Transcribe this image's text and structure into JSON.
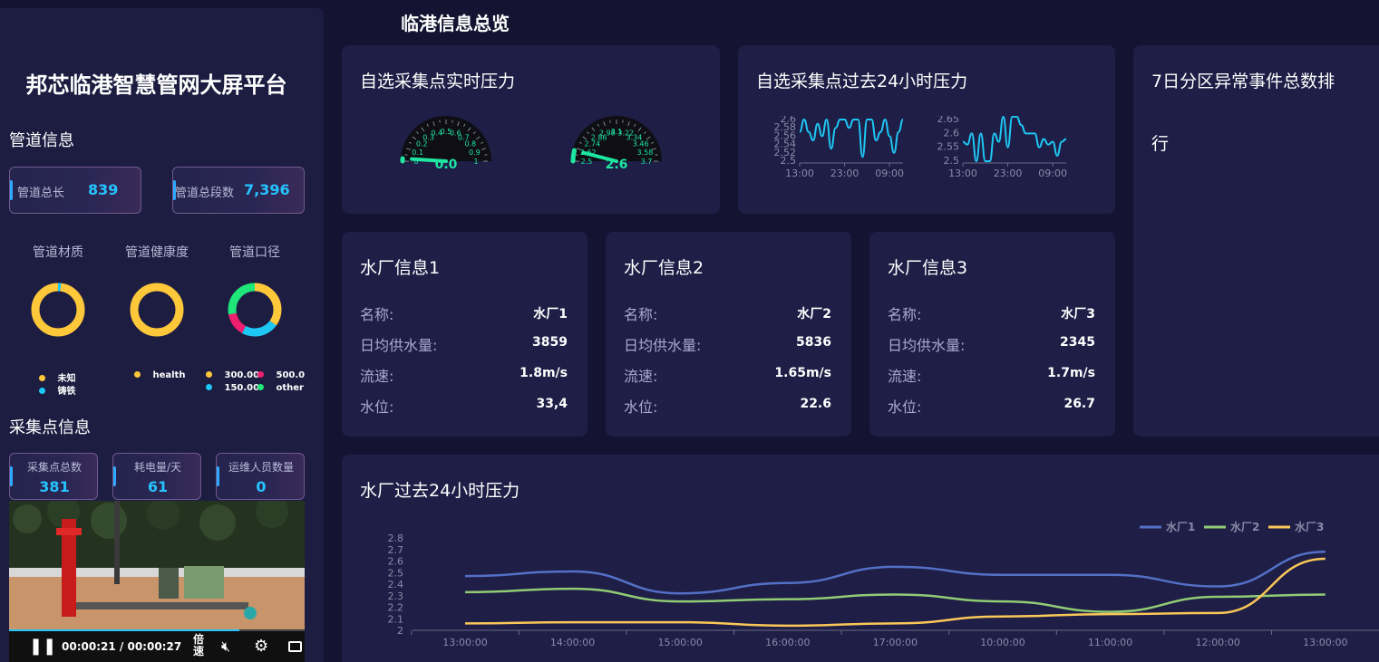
{
  "header": {
    "title": "临港信息总览"
  },
  "sidebar": {
    "title": "邦芯临港智慧管网大屏平台",
    "pipeline_section": "管道信息",
    "pipe_length": {
      "label": "管道总长",
      "value": "839"
    },
    "pipe_segments": {
      "label": "管道总段数",
      "value": "7,396"
    },
    "donuts": [
      {
        "title": "管道材质",
        "legend": [
          {
            "label": "未知",
            "color": "#ffc83a"
          },
          {
            "label": "铸铁",
            "color": "#1ec8f5"
          }
        ]
      },
      {
        "title": "管道健康度",
        "legend": [
          {
            "label": "health",
            "color": "#ffc83a"
          }
        ]
      },
      {
        "title": "管道口径",
        "legend": [
          {
            "label": "300.00",
            "color": "#ffc83a"
          },
          {
            "label": "500.0",
            "color": "#f01e6e"
          },
          {
            "label": "150.00",
            "color": "#1ec8f5"
          },
          {
            "label": "other",
            "color": "#1ee678"
          }
        ]
      }
    ],
    "collect_section": "采集点信息",
    "collect_stats": [
      {
        "label": "采集点总数",
        "value": "381"
      },
      {
        "label": "耗电量/天",
        "value": "61"
      },
      {
        "label": "运维人员数量",
        "value": "0"
      }
    ],
    "video": {
      "current_time": "00:00:21",
      "separator": "/",
      "duration": "00:00:27",
      "speed_label": "倍速",
      "progress": 0.78
    }
  },
  "realtime_pressure": {
    "title": "自选采集点实时压力",
    "gauges": [
      {
        "value": "0.0",
        "ticks": [
          "0",
          "0.1",
          "0.2",
          "0.3",
          "0.4",
          "0.5",
          "0.6",
          "0.7",
          "0.8",
          "0.9",
          "1"
        ],
        "fraction": 0.02
      },
      {
        "value": "2.6",
        "ticks": [
          "2.5",
          "2.62",
          "2.74",
          "2.86",
          "2.98",
          "3.1",
          "3.22",
          "3.34",
          "3.46",
          "3.58",
          "3.7"
        ],
        "fraction": 0.08
      }
    ]
  },
  "past24_pressure": {
    "title": "自选采集点过去24小时压力"
  },
  "anomaly_rank": {
    "title_line1": "7日分区异常事件总数排",
    "title_line2": "行"
  },
  "plants": [
    {
      "title": "水厂信息1",
      "rows": [
        {
          "k": "名称:",
          "v": "水厂1"
        },
        {
          "k": "日均供水量:",
          "v": "3859"
        },
        {
          "k": "流速:",
          "v": "1.8m/s"
        },
        {
          "k": "水位:",
          "v": "33,4"
        }
      ]
    },
    {
      "title": "水厂信息2",
      "rows": [
        {
          "k": "名称:",
          "v": "水厂2"
        },
        {
          "k": "日均供水量:",
          "v": "5836"
        },
        {
          "k": "流速:",
          "v": "1.65m/s"
        },
        {
          "k": "水位:",
          "v": "22.6"
        }
      ]
    },
    {
      "title": "水厂信息3",
      "rows": [
        {
          "k": "名称:",
          "v": "水厂3"
        },
        {
          "k": "日均供水量:",
          "v": "2345"
        },
        {
          "k": "流速:",
          "v": "1.7m/s"
        },
        {
          "k": "水位:",
          "v": "26.7"
        }
      ]
    }
  ],
  "plant_pressure": {
    "title": "水厂过去24小时压力"
  },
  "colors": {
    "accent": "#25c3ff",
    "panel": "#1e1e46",
    "background": "#141432"
  },
  "chart_data": [
    {
      "type": "line",
      "x": [
        "13:00",
        "14:00",
        "15:00",
        "16:00",
        "17:00",
        "18:00",
        "19:00",
        "20:00",
        "21:00",
        "22:00",
        "23:00",
        "00:00",
        "01:00",
        "02:00",
        "03:00",
        "04:00",
        "05:00",
        "06:00",
        "07:00",
        "08:00",
        "09:00",
        "10:00",
        "11:00",
        "12:00"
      ],
      "xticks": [
        "13:00",
        "23:00",
        "09:00"
      ],
      "yticks": [
        "2.5",
        "2.52",
        "2.54",
        "2.56",
        "2.58",
        "2.6"
      ],
      "ylim": [
        2.5,
        2.6
      ],
      "series": [
        {
          "values": [
            2.57,
            2.6,
            2.57,
            2.55,
            2.59,
            2.56,
            2.6,
            2.53,
            2.58,
            2.6,
            2.6,
            2.58,
            2.6,
            2.6,
            2.51,
            2.6,
            2.6,
            2.55,
            2.57,
            2.6,
            2.56,
            2.52,
            2.57,
            2.6
          ],
          "color": "#1ec8f5"
        }
      ]
    },
    {
      "type": "line",
      "x": [
        "13:00",
        "14:00",
        "15:00",
        "16:00",
        "17:00",
        "18:00",
        "19:00",
        "20:00",
        "21:00",
        "22:00",
        "23:00",
        "00:00",
        "01:00",
        "02:00",
        "03:00",
        "04:00",
        "05:00",
        "06:00",
        "07:00",
        "08:00",
        "09:00",
        "10:00",
        "11:00",
        "12:00"
      ],
      "xticks": [
        "13:00",
        "23:00",
        "09:00"
      ],
      "yticks": [
        "2.5",
        "2.55",
        "2.6",
        "2.65"
      ],
      "ylim": [
        2.5,
        2.65
      ],
      "series": [
        {
          "values": [
            2.57,
            2.56,
            2.6,
            2.5,
            2.6,
            2.5,
            2.5,
            2.6,
            2.57,
            2.66,
            2.55,
            2.66,
            2.66,
            2.63,
            2.6,
            2.6,
            2.6,
            2.55,
            2.58,
            2.56,
            2.57,
            2.52,
            2.57,
            2.58
          ],
          "color": "#1ec8f5"
        }
      ]
    },
    {
      "type": "line",
      "x": [
        "13:00:00",
        "14:00:00",
        "15:00:00",
        "16:00:00",
        "17:00:00",
        "10:00:00",
        "11:00:00",
        "12:00:00",
        "13:00:00"
      ],
      "ylim": [
        2,
        2.8
      ],
      "yticks": [
        "2",
        "2.1",
        "2.2",
        "2.3",
        "2.4",
        "2.5",
        "2.6",
        "2.7",
        "2.8"
      ],
      "legend_position": "top-right",
      "series": [
        {
          "name": "水厂1",
          "color": "#5470c6",
          "values": [
            2.47,
            2.51,
            2.32,
            2.41,
            2.55,
            2.48,
            2.48,
            2.38,
            2.68
          ]
        },
        {
          "name": "水厂2",
          "color": "#91cc75",
          "values": [
            2.33,
            2.36,
            2.25,
            2.27,
            2.31,
            2.25,
            2.16,
            2.29,
            2.31
          ]
        },
        {
          "name": "水厂3",
          "color": "#fac858",
          "values": [
            2.06,
            2.07,
            2.07,
            2.04,
            2.06,
            2.12,
            2.14,
            2.15,
            2.62
          ]
        }
      ]
    }
  ]
}
